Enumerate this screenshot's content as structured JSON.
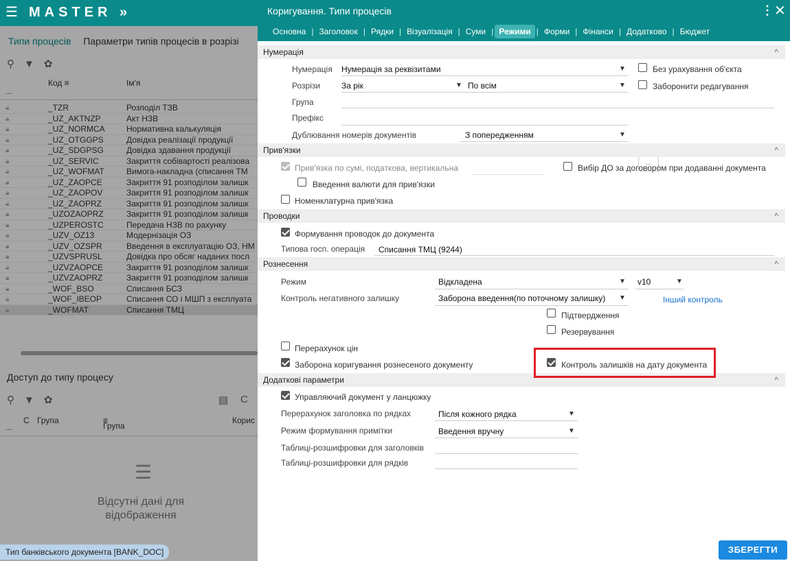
{
  "app": {
    "logo": "MASTER",
    "logo_arrows": "»",
    "menu_icon": "☰"
  },
  "left": {
    "tabs": [
      {
        "label": "Типи процесів",
        "active": true
      },
      {
        "label": "Параметри типів процесів в розрізі",
        "active": false
      }
    ],
    "columns": {
      "dots": "...",
      "code": "Код",
      "name": "Ім'я"
    },
    "rows": [
      {
        "code": "_TZR",
        "name": "Розподіл ТЗВ"
      },
      {
        "code": "_UZ_AKTNZP",
        "name": "Акт НЗВ"
      },
      {
        "code": "_UZ_NORMCA",
        "name": "Нормативна калькуляція"
      },
      {
        "code": "_UZ_OTGGPS",
        "name": "Довідка реалізації продукції"
      },
      {
        "code": "_UZ_SDGPSG",
        "name": "Довідка здавання продукції"
      },
      {
        "code": "_UZ_SERVIC",
        "name": "Закриття собівартості реалізова"
      },
      {
        "code": "_UZ_WOFMAT",
        "name": "Вимога-накладна (списання ТМ"
      },
      {
        "code": "_UZ_ZAOPCE",
        "name": "Закриття 91 розподілом залишк"
      },
      {
        "code": "_UZ_ZAOPOV",
        "name": "Закриття 91 розподілом залишк"
      },
      {
        "code": "_UZ_ZAOPRZ",
        "name": "Закриття 91 розподілом залишк"
      },
      {
        "code": "_UZOZAOPRZ",
        "name": "Закриття 91 розподілом залишк"
      },
      {
        "code": "_UZPEROSTC",
        "name": "Передача НЗВ по рахунку"
      },
      {
        "code": "_UZV_OZ13",
        "name": "Модернізація ОЗ"
      },
      {
        "code": "_UZV_OZSPR",
        "name": "Введення в експлуатацію ОЗ, НМ"
      },
      {
        "code": "_UZVSPRUSL",
        "name": "Довідка про обсяг наданих посл"
      },
      {
        "code": "_UZVZAOPCE",
        "name": "Закриття 91 розподілом залишк"
      },
      {
        "code": "_UZVZAOPRZ",
        "name": "Закриття 91 розподілом залишк"
      },
      {
        "code": "_WOF_BSO",
        "name": "Списання БСЗ"
      },
      {
        "code": "_WOF_IBEOP",
        "name": "Списання СО і МШП з експлуата"
      },
      {
        "code": "_WOFMAT",
        "name": "Списання ТМЦ"
      }
    ],
    "access_title": "Доступ до типу процесу",
    "access_columns": {
      "dots": "...",
      "c": "С",
      "group1": "Група",
      "group2": "Група",
      "user": "Корис"
    },
    "empty_line1": "Відсутні дані для",
    "empty_line2": "відображення",
    "status": "Тип банківського документа [BANK_DOC]"
  },
  "dialog": {
    "title": "Коригування. Типи процесів",
    "tabs": [
      "Основна",
      "Заголовок",
      "Рядки",
      "Візуалізація",
      "Суми",
      "Режими",
      "Форми",
      "Фінанси",
      "Додатково",
      "Бюджет"
    ],
    "active_tab": "Режими",
    "numbering": {
      "title": "Нумерація",
      "numbering_label": "Нумерація",
      "numbering_value": "Нумерація за реквізитами",
      "ignore_object": "Без урахування об'єкта",
      "cuts_label": "Розрізи",
      "cuts_value": "За рік",
      "cuts_value2": "По всім",
      "forbid_edit": "Заборонити редагування",
      "group_label": "Група",
      "prefix_label": "Префікс",
      "prefix_btn": "...",
      "dup_label": "Дублювання номерів документів",
      "dup_value": "З попередженням"
    },
    "links": {
      "title": "Прив'язки",
      "sum_link": "Прив'язка по сумі, податкова, вертикальна",
      "choose_do": "Вибір ДО за договором при додаванні документа",
      "currency": "Введення валюти для прив'язки",
      "nomenclature": "Номенклатурна прив'язка"
    },
    "postings": {
      "title": "Проводки",
      "form": "Формування проводок до документа",
      "op_label": "Типова госп. операція",
      "op_value": "Списання ТМЦ (9244)"
    },
    "posting_mode": {
      "title": "Рознесення",
      "mode_label": "Режим",
      "mode_value": "Відкладена",
      "version": "v10",
      "neg_label": "Контроль негативного залишку",
      "neg_value": "Заборона введення(по поточному залишку)",
      "other_control": "Інший контроль",
      "confirm": "Підтвердження",
      "reserve": "Резервування",
      "recalc": "Перерахунок цін",
      "forbid_correct": "Заборона коригування рознесеного документу",
      "control_date": "Контроль залишків на дату документа"
    },
    "extra": {
      "title": "Додаткові параметри",
      "managing": "Управляючий документ у ланцюжку",
      "recalc_label": "Перерахунок заголовка по рядках",
      "recalc_value": "Після кожного рядка",
      "note_label": "Режим формування примітки",
      "note_value": "Введення вручну",
      "tables_headers": "Таблиці-розшифровки для заголовків",
      "tables_rows": "Таблиці-розшифровки для рядків"
    },
    "save": "ЗБЕРЕГТИ"
  }
}
